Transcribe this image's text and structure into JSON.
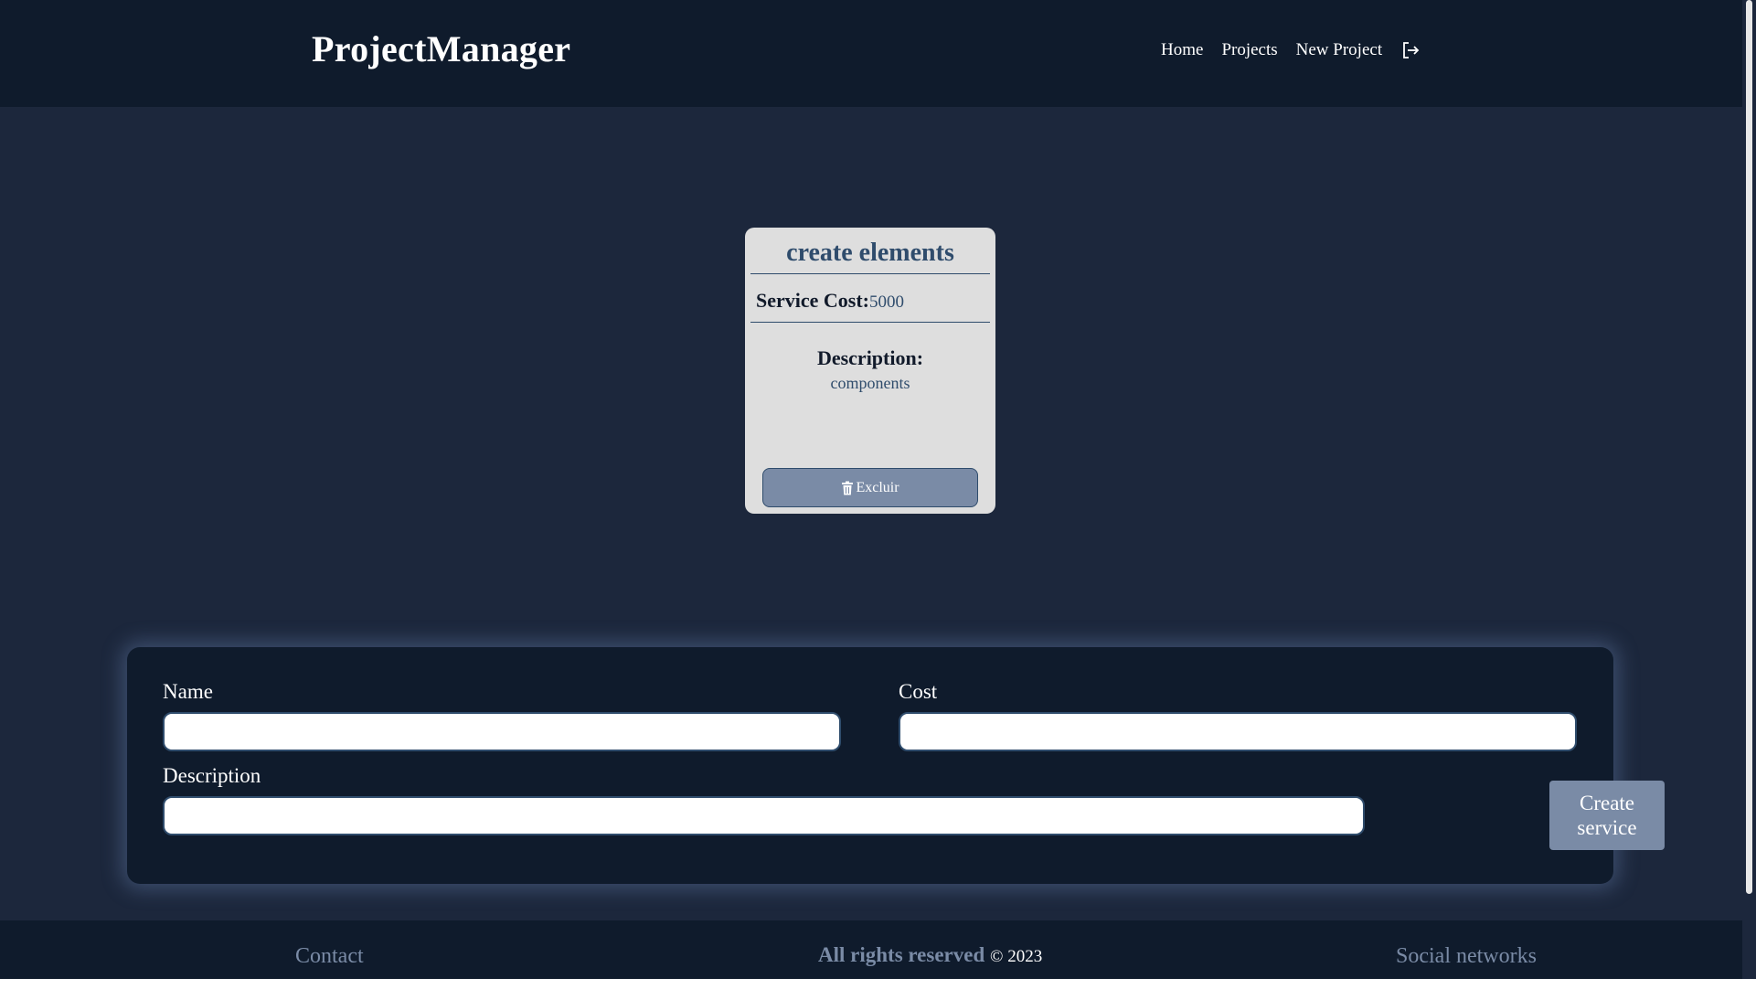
{
  "header": {
    "brand": "ProjectManager",
    "nav": {
      "home": "Home",
      "projects": "Projects",
      "new_project": "New Project",
      "logout_icon": "logout-icon"
    }
  },
  "service_card": {
    "title": "create elements",
    "cost_label": "Service Cost:",
    "cost_value": "5000",
    "description_label": "Description:",
    "description_value": "components",
    "delete_label": "Excluir",
    "delete_icon": "trash-icon"
  },
  "service_form": {
    "name_label": "Name",
    "name_value": "",
    "cost_label": "Cost",
    "cost_value": "",
    "description_label": "Description",
    "description_value": "",
    "submit_label_line1": "Create",
    "submit_label_line2": "service"
  },
  "footer": {
    "contact": "Contact",
    "rights_bold": "All rights reserved",
    "copyright": "© 2023",
    "social": "Social networks"
  },
  "colors": {
    "page_bg": "#1c273c",
    "header_bg": "#0f1b2c",
    "card_bg": "#dedede",
    "accent": "#2f4c6c",
    "button_bg": "#7a8ba6"
  }
}
